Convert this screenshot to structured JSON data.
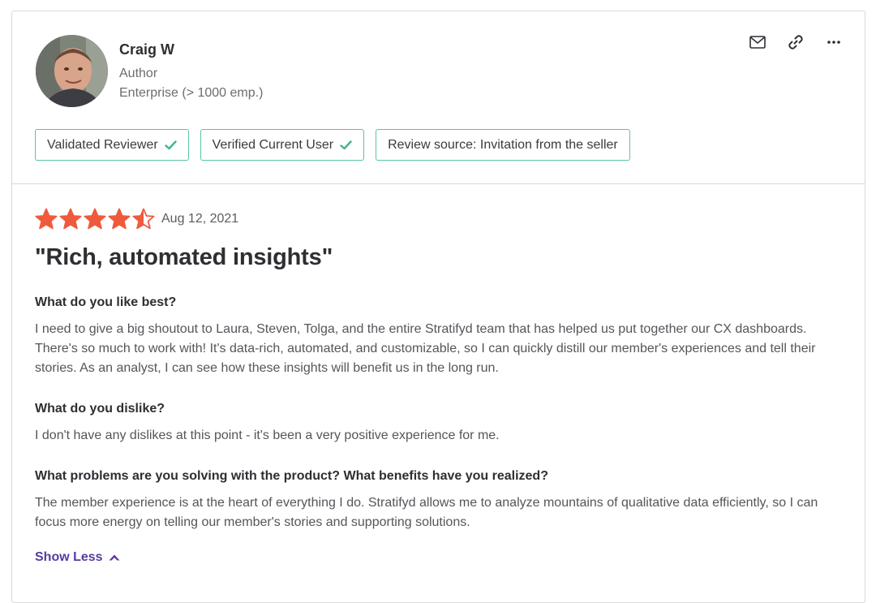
{
  "user": {
    "name": "Craig W",
    "role": "Author",
    "company": "Enterprise (> 1000 emp.)"
  },
  "actions": [
    {
      "icon": "mail-icon"
    },
    {
      "icon": "link-icon"
    },
    {
      "icon": "more-icon"
    }
  ],
  "badges": {
    "validated": "Validated Reviewer",
    "verified": "Verified Current User",
    "source": "Review source: Invitation from the seller"
  },
  "review": {
    "rating": 4.5,
    "max_rating": 5,
    "date": "Aug 12, 2021",
    "title": "\"Rich, automated insights\"",
    "q1": "What do you like best?",
    "a1": "I need to give a big shoutout to Laura, Steven, Tolga, and the entire Stratifyd team that has helped us put together our CX dashboards. There's so much to work with! It's data-rich, automated, and customizable, so I can quickly distill our member's experiences and tell their stories. As an analyst, I can see how these insights will benefit us in the long run.",
    "q2": "What do you dislike?",
    "a2": "I don't have any dislikes at this point - it's been a very positive experience for me.",
    "q3": "What problems are you solving with the product? What benefits have you realized?",
    "a3": "The member experience is at the heart of everything I do. Stratifyd allows me to analyze mountains of qualitative data efficiently, so I can focus more energy on telling our member's stories and supporting solutions.",
    "show_less": "Show Less"
  },
  "colors": {
    "star": "#f05a3c",
    "check": "#3fb58f",
    "badge_border": "#5ac4a7",
    "link": "#5a39a2"
  }
}
